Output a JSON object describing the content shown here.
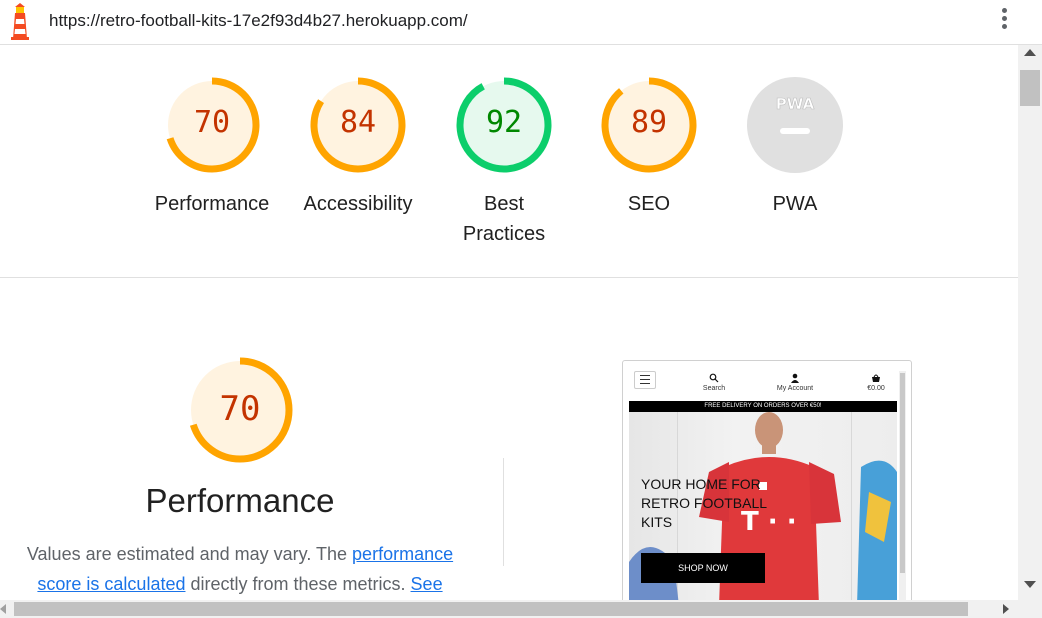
{
  "address_bar": {
    "url": "https://retro-football-kits-17e2f93d4b27.herokuapp.com/"
  },
  "colors": {
    "average": "#ffa400",
    "average_fill": "#fff3e0",
    "average_text": "#c33300",
    "pass": "#0cce6b",
    "pass_fill": "#e6f9ee",
    "pass_text": "#008800",
    "na": "#e0e0e0",
    "link": "#1a73e8"
  },
  "gauges": [
    {
      "score": "70",
      "label": "Performance",
      "fraction": 0.7,
      "rating": "average"
    },
    {
      "score": "84",
      "label": "Accessibility",
      "fraction": 0.84,
      "rating": "average"
    },
    {
      "score": "92",
      "label": "Best Practices",
      "fraction": 0.92,
      "rating": "pass"
    },
    {
      "score": "89",
      "label": "SEO",
      "fraction": 0.89,
      "rating": "average"
    },
    {
      "score": "PWA",
      "label": "PWA",
      "fraction": 0,
      "rating": "na"
    }
  ],
  "performance": {
    "score": "70",
    "title": "Performance",
    "desc_prefix": "Values are estimated and may vary. The ",
    "desc_link": "performance score is calculated",
    "desc_middle": " directly from these metrics. ",
    "desc_link2": "See"
  },
  "screenshot": {
    "nav_search": "Search",
    "nav_account": "My Account",
    "nav_basket": "€0.00",
    "banner": "FREE DELIVERY ON ORDERS OVER €50!",
    "hero_heading": "YOUR HOME FOR RETRO FOOTBALL KITS",
    "hero_button": "SHOP NOW"
  },
  "icons": [
    "lighthouse-logo-icon",
    "kebab-menu-icon",
    "hamburger-icon",
    "search-icon",
    "account-icon",
    "basket-icon"
  ]
}
